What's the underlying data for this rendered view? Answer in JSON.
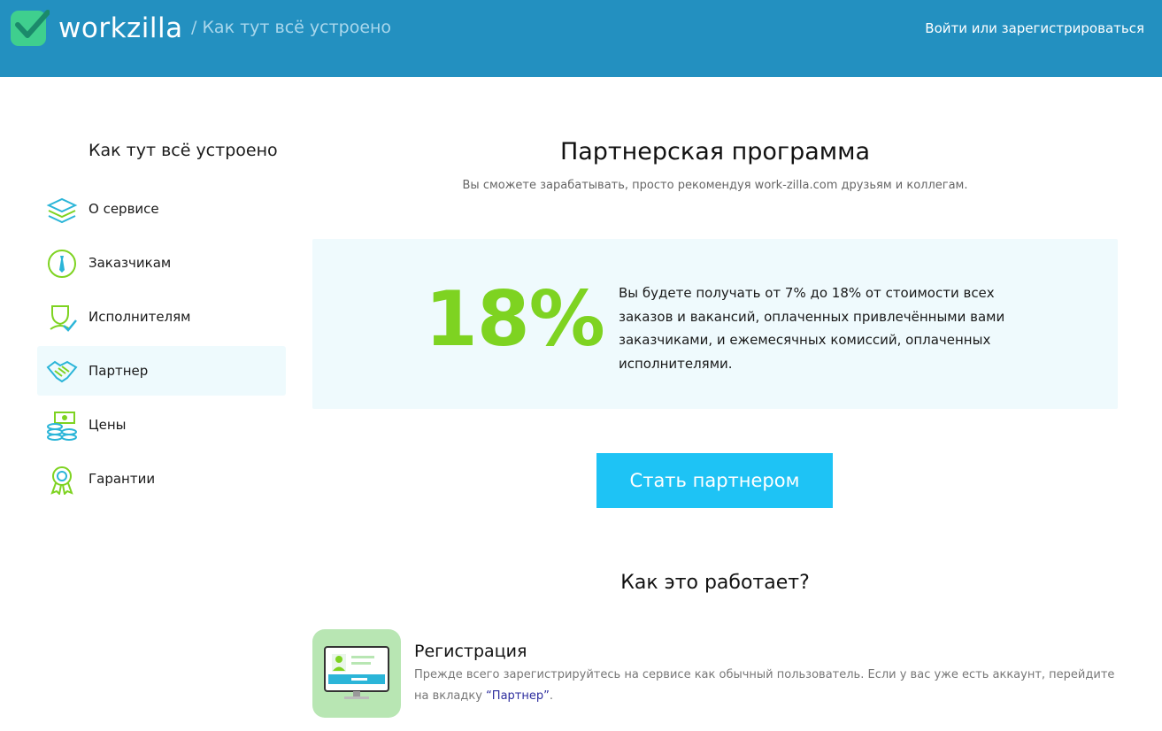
{
  "header": {
    "logo_text": "workzilla",
    "breadcrumb": "/ Как тут всё устроено",
    "login_link": "Войти или зарегистрироваться"
  },
  "sidebar": {
    "title": "Как тут всё устроено",
    "items": [
      {
        "label": "О сервисе",
        "icon": "layers-icon",
        "active": false
      },
      {
        "label": "Заказчикам",
        "icon": "tie-person-icon",
        "active": false
      },
      {
        "label": "Исполнителям",
        "icon": "worker-check-icon",
        "active": false
      },
      {
        "label": "Партнер",
        "icon": "handshake-icon",
        "active": true
      },
      {
        "label": "Цены",
        "icon": "money-stack-icon",
        "active": false
      },
      {
        "label": "Гарантии",
        "icon": "award-badge-icon",
        "active": false
      }
    ]
  },
  "main": {
    "title": "Партнерская программа",
    "subtitle": "Вы сможете зарабатывать, просто рекомендуя work-zilla.com друзьям и коллегам.",
    "promo": {
      "percent": "18%",
      "text": "Вы будете получать от 7% до 18% от стоимости всех заказов и вакансий, оплаченных привлечёнными вами заказчиками, и ежемесячных комиссий, оплаченных исполнителями."
    },
    "cta_label": "Стать партнером",
    "how_title": "Как это работает?",
    "steps": [
      {
        "title": "Регистрация",
        "desc_before": "Прежде всего зарегистрируйтесь на сервисе как обычный пользователь. Если у вас уже есть аккаунт, перейдите на вкладку ",
        "link_text": "“Партнер”",
        "desc_after": ".",
        "icon": "computer-profile-icon"
      }
    ]
  },
  "colors": {
    "header_bg": "#2390c0",
    "accent_green": "#7ed321",
    "cta_bg": "#1ec3f5",
    "promo_bg": "#effafd"
  }
}
